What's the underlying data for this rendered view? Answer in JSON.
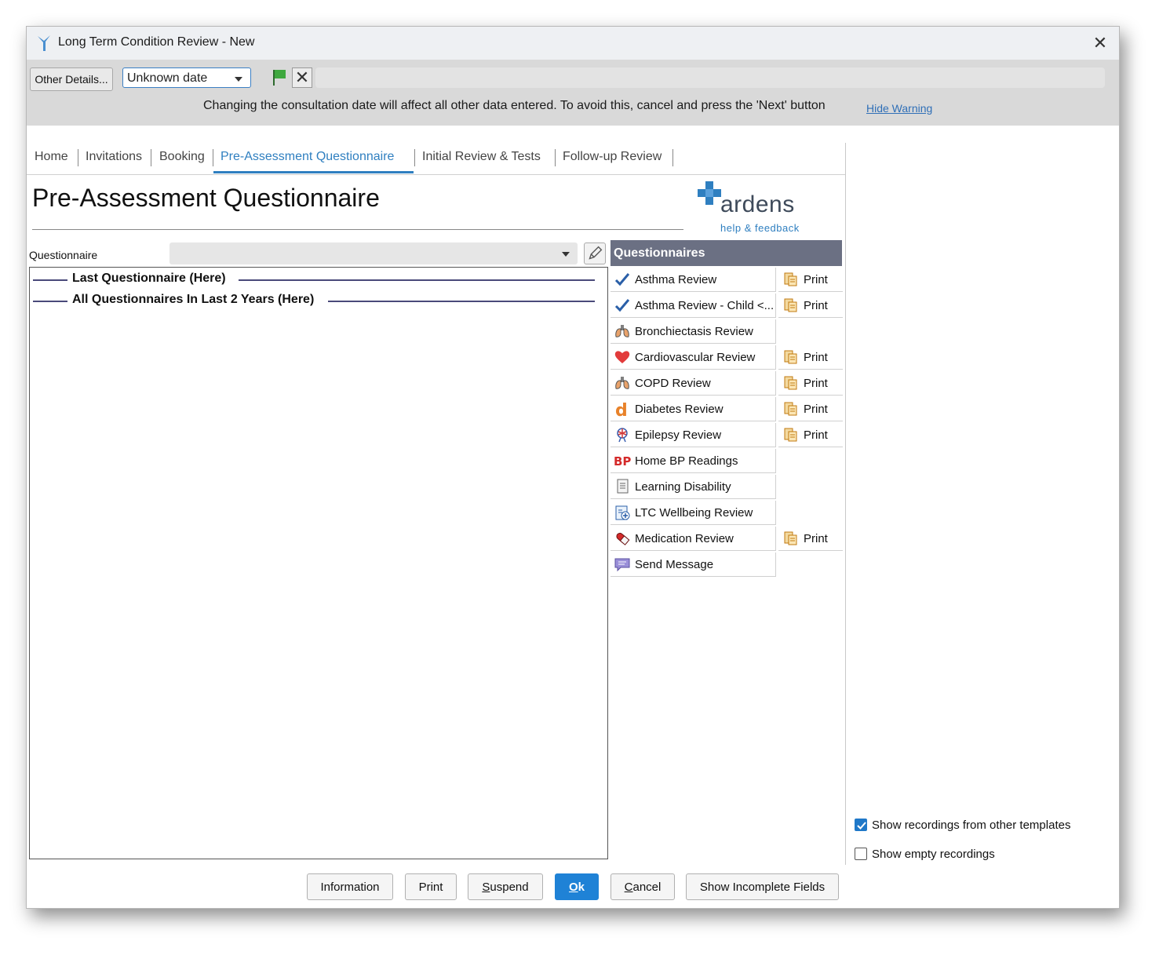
{
  "window": {
    "title": "Long Term Condition Review - New",
    "close_glyph": "✕"
  },
  "toolbar": {
    "other_details": "Other Details...",
    "date_value": "Unknown date",
    "clear_glyph": "✕",
    "warning_text": "Changing the consultation date will affect all other data entered. To avoid this, cancel and press the 'Next' button",
    "hide_warning": "Hide Warning"
  },
  "tabs": [
    "Home",
    "Invitations",
    "Booking",
    "Pre-Assessment Questionnaire",
    "Initial Review & Tests",
    "Follow-up Review"
  ],
  "active_tab": "Pre-Assessment Questionnaire",
  "page": {
    "title": "Pre-Assessment Questionnaire",
    "logo_text": "ardens",
    "logo_sub": "help & feedback",
    "questionnaire_label": "Questionnaire"
  },
  "sections": [
    "Last Questionnaire (Here)",
    "All Questionnaires In Last 2 Years (Here)"
  ],
  "questionnaires": {
    "header": "Questionnaires",
    "print_label": "Print",
    "items": [
      {
        "label": "Asthma Review",
        "icon": "checkmark-icon",
        "print": true
      },
      {
        "label": "Asthma Review - Child <...",
        "icon": "checkmark-icon",
        "print": true
      },
      {
        "label": "Bronchiectasis Review",
        "icon": "lungs-icon",
        "print": false
      },
      {
        "label": "Cardiovascular Review",
        "icon": "heart-icon",
        "print": true
      },
      {
        "label": "COPD Review",
        "icon": "lungs-icon",
        "print": true
      },
      {
        "label": "Diabetes Review",
        "icon": "diabetes-d-icon",
        "print": true
      },
      {
        "label": "Epilepsy Review",
        "icon": "brain-icon",
        "print": true
      },
      {
        "label": "Home BP Readings",
        "icon": "bp-icon",
        "print": false
      },
      {
        "label": "Learning Disability",
        "icon": "document-icon",
        "print": false
      },
      {
        "label": "LTC Wellbeing Review",
        "icon": "clipboard-icon",
        "print": false
      },
      {
        "label": "Medication Review",
        "icon": "pill-icon",
        "print": true
      },
      {
        "label": "Send Message",
        "icon": "message-icon",
        "print": false
      }
    ]
  },
  "options": {
    "show_other_templates": {
      "label": "Show recordings from other templates",
      "checked": true
    },
    "show_empty": {
      "label": "Show empty recordings",
      "checked": false
    }
  },
  "footer": {
    "information": "Information",
    "print": "Print",
    "suspend_u": "S",
    "suspend_rest": "uspend",
    "ok_u": "O",
    "ok_rest": "k",
    "cancel_u": "C",
    "cancel_rest": "ancel",
    "show_incomplete": "Show Incomplete Fields"
  },
  "colors": {
    "accent": "#2f7fc0",
    "panel_header": "#6b7083",
    "ok_button": "#1f82d6"
  }
}
